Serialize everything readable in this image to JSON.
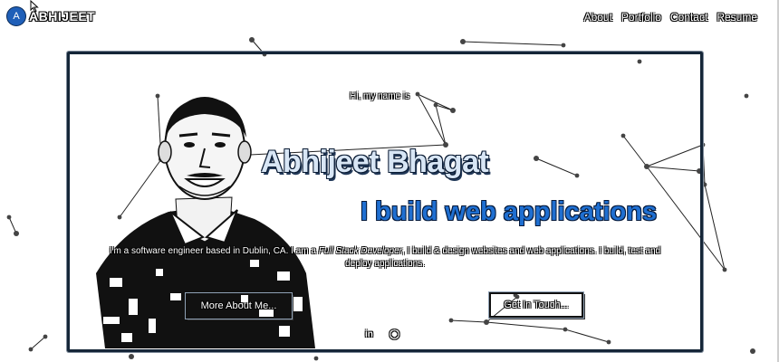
{
  "header": {
    "logo_letter": "A",
    "logo_text": "ABHIJEET",
    "nav": [
      "About",
      "Portfolio",
      "Contact",
      "Resume"
    ]
  },
  "hero": {
    "greeting": "Hi, my name is",
    "name": "Abhijeet Bhagat",
    "tagline": "I build web applications",
    "bio_before": "I'm a software engineer based in Dublin, CA. I am a ",
    "bio_role": "Full Stack Developer",
    "bio_after": ", I build & design websites and web applications. I build, test and deploy applications.",
    "buttons": {
      "more": "More About Me...",
      "contact": "Get In Touch..."
    },
    "social": [
      "linkedin-icon",
      "github-icon"
    ]
  },
  "colors": {
    "accent_blue": "#1f6fd1",
    "frame_border": "#152638",
    "background": "#ffffff"
  }
}
